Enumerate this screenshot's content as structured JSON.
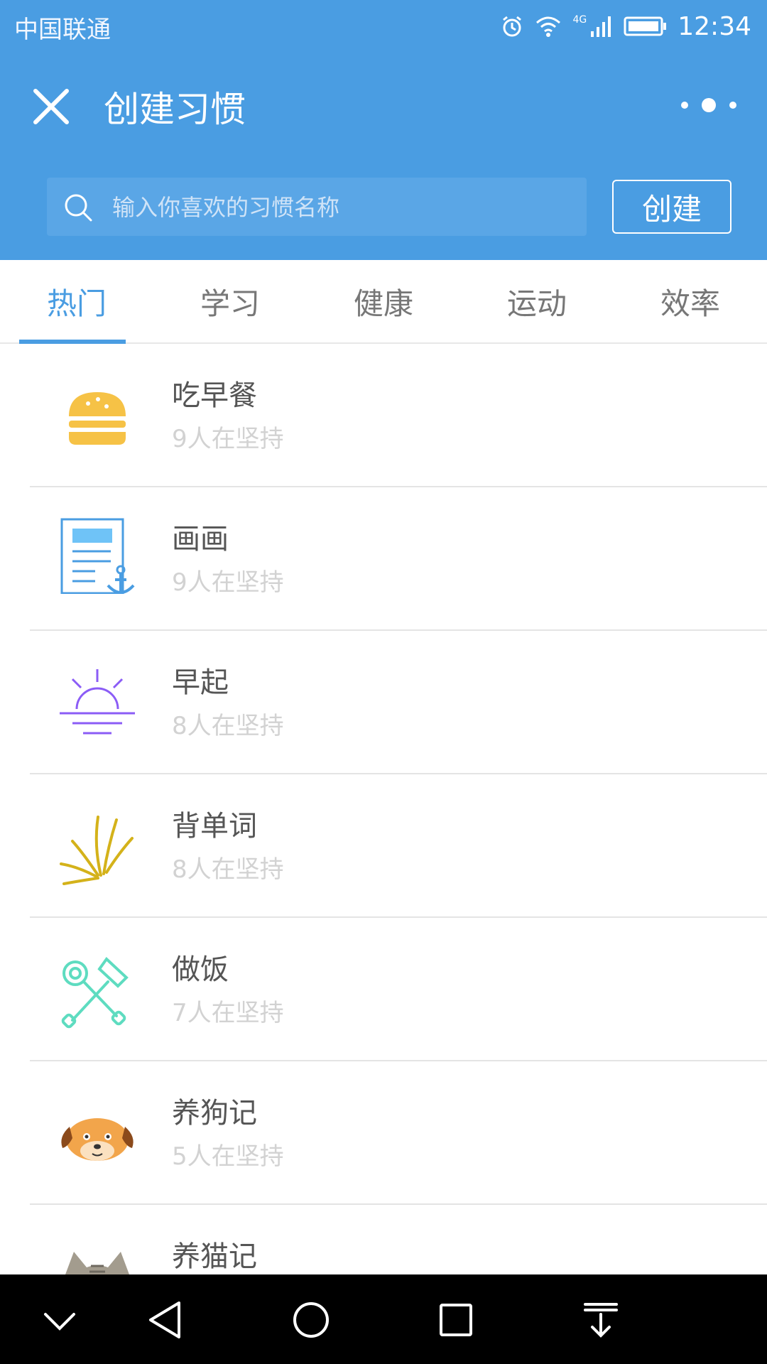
{
  "status_bar": {
    "carrier": "中国联通",
    "network": "4G",
    "time": "12:34"
  },
  "header": {
    "title": "创建习惯",
    "close_icon": "close-icon",
    "more_icon": "more-icon"
  },
  "search": {
    "placeholder": "输入你喜欢的习惯名称",
    "value": "",
    "create_label": "创建"
  },
  "tabs": [
    {
      "label": "热门",
      "active": true
    },
    {
      "label": "学习"
    },
    {
      "label": "健康"
    },
    {
      "label": "运动"
    },
    {
      "label": "效率"
    }
  ],
  "habits": [
    {
      "name": "吃早餐",
      "count": "9人在坚持",
      "icon": "burger-icon"
    },
    {
      "name": "画画",
      "count": "9人在坚持",
      "icon": "document-anchor-icon"
    },
    {
      "name": "早起",
      "count": "8人在坚持",
      "icon": "sunrise-icon"
    },
    {
      "name": "背单词",
      "count": "8人在坚持",
      "icon": "spark-lines-icon"
    },
    {
      "name": "做饭",
      "count": "7人在坚持",
      "icon": "kitchen-utensils-icon"
    },
    {
      "name": "养狗记",
      "count": "5人在坚持",
      "icon": "dog-face-icon"
    },
    {
      "name": "养猫记",
      "count": "",
      "icon": "cat-face-icon"
    }
  ],
  "colors": {
    "primary": "#4A9DE2",
    "tab_active": "#4A9DE2",
    "text": "#555555",
    "muted": "#d2d2d2"
  },
  "navbar": [
    "chevron-down-icon",
    "back-icon",
    "home-icon",
    "recents-icon",
    "notification-pull-icon"
  ]
}
